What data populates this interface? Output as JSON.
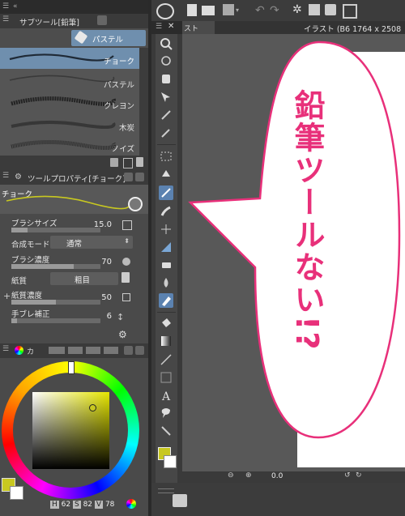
{
  "subtool_panel": {
    "title": "サブツール[鉛筆]",
    "tab_label": "パステル",
    "brushes": [
      {
        "label": "チョーク",
        "selected": true
      },
      {
        "label": "パステル",
        "selected": false
      },
      {
        "label": "クレヨン",
        "selected": false
      },
      {
        "label": "木炭",
        "selected": false
      },
      {
        "label": "ノイズ",
        "selected": false
      }
    ]
  },
  "tool_property": {
    "title": "ツールプロパティ[チョーク]",
    "preset_name": "チョーク",
    "rows": {
      "brush_size": {
        "label": "ブラシサイズ",
        "value": "15.0",
        "fill": 0.18
      },
      "blend_mode": {
        "label": "合成モード",
        "value": "通常"
      },
      "brush_density": {
        "label": "ブラシ濃度",
        "value": "70",
        "fill": 0.7
      },
      "paper": {
        "label": "紙質",
        "value": "粗目"
      },
      "paper_density": {
        "label": "紙質濃度",
        "value": "50",
        "fill": 0.5
      },
      "stabilization": {
        "label": "手ブレ補正",
        "value": "6",
        "fill": 0.06
      }
    }
  },
  "color_panel": {
    "tab_label": "カ",
    "hsv": {
      "h_label": "H",
      "h": "62",
      "s_label": "S",
      "s": "82",
      "v_label": "V",
      "v": "78"
    },
    "main_color": "#c8c820",
    "sub_color": "#ffffff"
  },
  "canvas": {
    "tab_label": "スト",
    "doc_title": "イラスト (B6 1764 x 2508",
    "zoom_value": "0.0"
  },
  "annotation": {
    "text": "鉛筆ツールない!?",
    "color": "#e8307a"
  },
  "colors": {
    "accent": "#5b82b0",
    "bubble_border": "#e8307a"
  }
}
